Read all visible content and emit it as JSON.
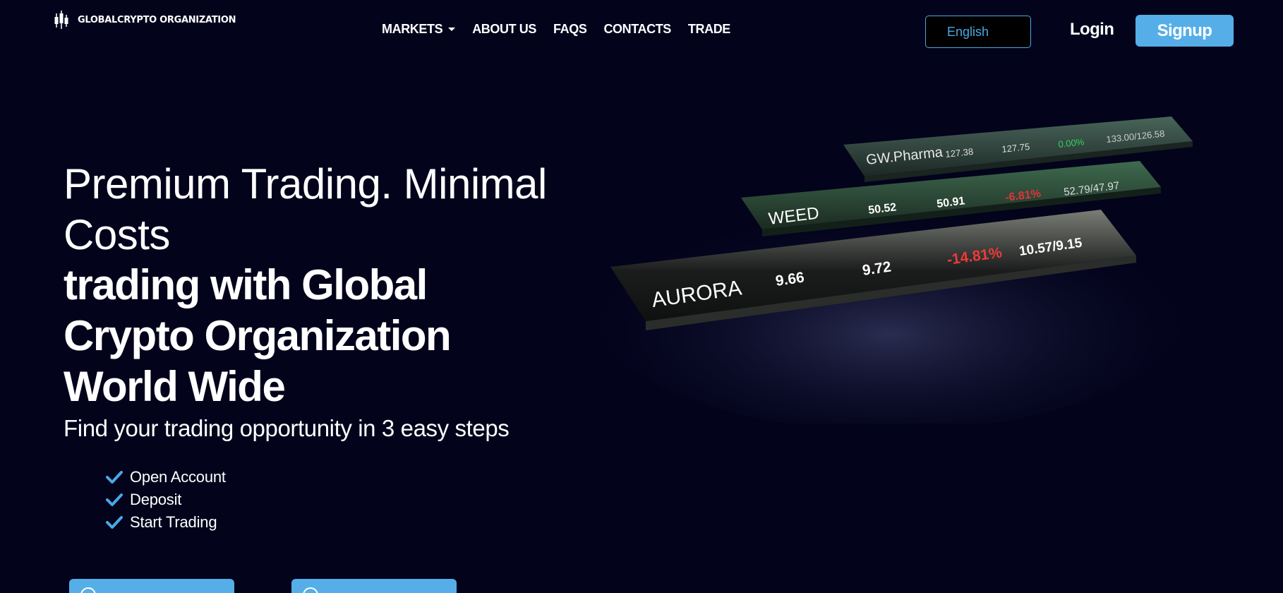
{
  "header": {
    "logo_text": "GLOBALCRYPTO ORGANIZATION",
    "nav": [
      {
        "label": "MARKETS",
        "has_dropdown": true
      },
      {
        "label": "ABOUT US"
      },
      {
        "label": "FAQS"
      },
      {
        "label": "CONTACTS"
      },
      {
        "label": "TRADE"
      }
    ],
    "language": "English",
    "login_label": "Login",
    "signup_label": "Signup"
  },
  "hero": {
    "title": "Premium Trading. Minimal Costs",
    "subtitle": "trading with Global Crypto Organization World Wide",
    "steps_title": "Find your trading opportunity in 3 easy steps",
    "steps": [
      "Open Account",
      "Deposit",
      "Start Trading"
    ]
  },
  "ticker_boards": [
    {
      "symbol": "GW.Pharma",
      "bid": "127.38",
      "ask": "127.75",
      "change": "0.00%",
      "range": "133.00/126.58",
      "change_color": "#35d35a"
    },
    {
      "symbol": "WEED",
      "bid": "50.52",
      "ask": "50.91",
      "change": "-6.81%",
      "range": "52.79/47.97",
      "change_color": "#e0343a"
    },
    {
      "symbol": "AURORA",
      "bid": "9.66",
      "ask": "9.72",
      "change": "-14.81%",
      "range": "10.57/9.15",
      "change_color": "#ee3a3a"
    }
  ],
  "colors": {
    "background": "#03031c",
    "accent": "#55aee8",
    "check": "#4aa8e6"
  }
}
